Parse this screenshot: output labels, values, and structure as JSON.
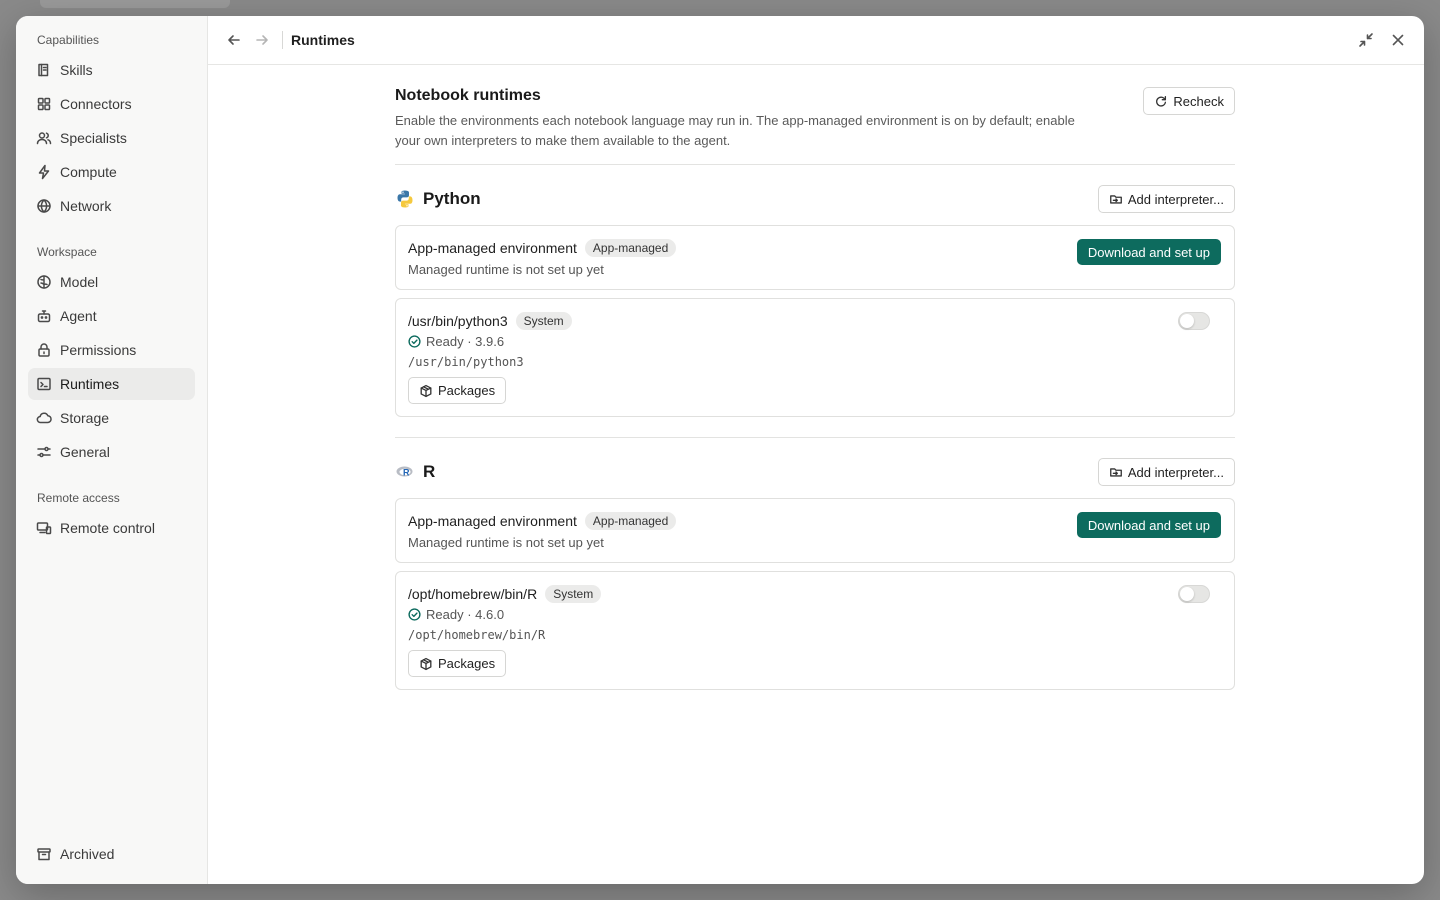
{
  "sidebar": {
    "sections": [
      {
        "label": "Capabilities",
        "items": [
          {
            "label": "Skills",
            "icon": "book-icon"
          },
          {
            "label": "Connectors",
            "icon": "grid-icon"
          },
          {
            "label": "Specialists",
            "icon": "users-icon"
          },
          {
            "label": "Compute",
            "icon": "bolt-icon"
          },
          {
            "label": "Network",
            "icon": "globe-icon"
          }
        ]
      },
      {
        "label": "Workspace",
        "items": [
          {
            "label": "Model",
            "icon": "brain-icon"
          },
          {
            "label": "Agent",
            "icon": "robot-icon"
          },
          {
            "label": "Permissions",
            "icon": "lock-icon"
          },
          {
            "label": "Runtimes",
            "icon": "terminal-icon",
            "active": true
          },
          {
            "label": "Storage",
            "icon": "cloud-icon"
          },
          {
            "label": "General",
            "icon": "sliders-icon"
          }
        ]
      },
      {
        "label": "Remote access",
        "items": [
          {
            "label": "Remote control",
            "icon": "devices-icon"
          }
        ]
      }
    ],
    "archived": {
      "label": "Archived",
      "icon": "archive-icon"
    }
  },
  "topbar": {
    "title": "Runtimes"
  },
  "main": {
    "title": "Notebook runtimes",
    "description": "Enable the environments each notebook language may run in. The app-managed environment is on by default; enable your own interpreters to make them available to the agent.",
    "recheck_label": "Recheck",
    "languages": [
      {
        "name": "Python",
        "icon": "python-icon",
        "add_label": "Add interpreter...",
        "managed": {
          "title": "App-managed environment",
          "badge": "App-managed",
          "subtitle": "Managed runtime is not set up yet",
          "action_label": "Download and set up"
        },
        "system": {
          "title": "/usr/bin/python3",
          "badge": "System",
          "status": "Ready · 3.9.6",
          "path": "/usr/bin/python3",
          "packages_label": "Packages",
          "enabled": false
        }
      },
      {
        "name": "R",
        "icon": "r-logo-icon",
        "add_label": "Add interpreter...",
        "managed": {
          "title": "App-managed environment",
          "badge": "App-managed",
          "subtitle": "Managed runtime is not set up yet",
          "action_label": "Download and set up"
        },
        "system": {
          "title": "/opt/homebrew/bin/R",
          "badge": "System",
          "status": "Ready · 4.6.0",
          "path": "/opt/homebrew/bin/R",
          "packages_label": "Packages",
          "enabled": false
        }
      }
    ]
  },
  "colors": {
    "accent": "#0d6b5e",
    "active_nav_bg": "#ebebea"
  }
}
